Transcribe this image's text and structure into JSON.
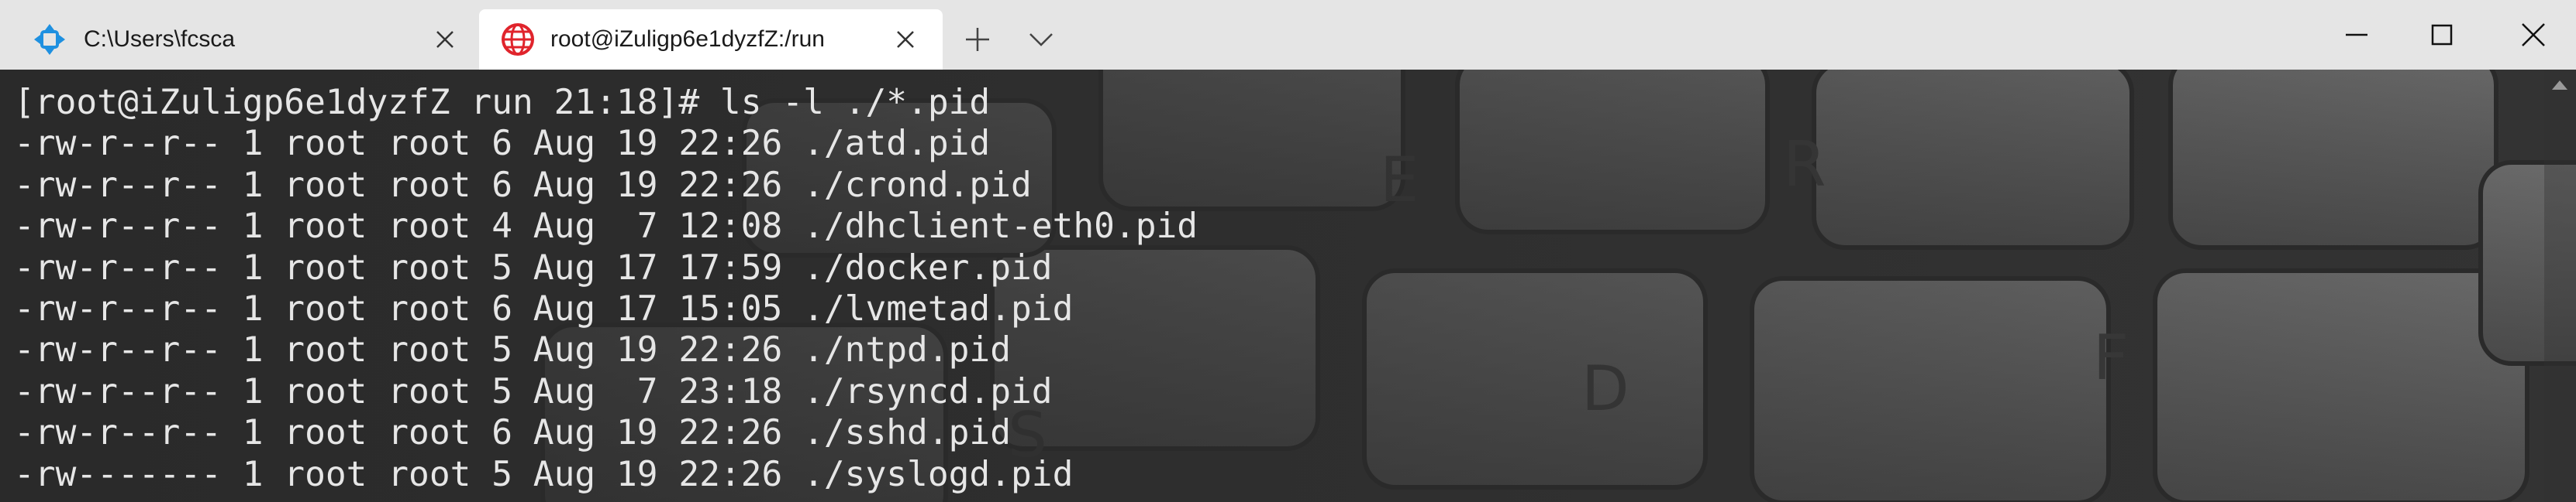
{
  "tabs": [
    {
      "title": "C:\\Users\\fcsca",
      "icon": "windows-terminal-icon",
      "active": false
    },
    {
      "title": "root@iZuligp6e1dyzfZ:/run",
      "icon": "globe-icon",
      "active": true
    }
  ],
  "window_controls": {
    "new_tab": "plus-icon",
    "dropdown": "chevron-down-icon",
    "minimize": "minimize-icon",
    "maximize": "maximize-icon",
    "close": "close-icon"
  },
  "terminal": {
    "lines": [
      "[root@iZuligp6e1dyzfZ run 21:18]# ls -l ./*.pid",
      "-rw-r--r-- 1 root root 6 Aug 19 22:26 ./atd.pid",
      "-rw-r--r-- 1 root root 6 Aug 19 22:26 ./crond.pid",
      "-rw-r--r-- 1 root root 4 Aug  7 12:08 ./dhclient-eth0.pid",
      "-rw-r--r-- 1 root root 5 Aug 17 17:59 ./docker.pid",
      "-rw-r--r-- 1 root root 6 Aug 17 15:05 ./lvmetad.pid",
      "-rw-r--r-- 1 root root 5 Aug 19 22:26 ./ntpd.pid",
      "-rw-r--r-- 1 root root 5 Aug  7 23:18 ./rsyncd.pid",
      "-rw-r--r-- 1 root root 6 Aug 19 22:26 ./sshd.pid",
      "-rw------- 1 root root 5 Aug 19 22:26 ./syslogd.pid"
    ],
    "background_key_letters": [
      "E",
      "R",
      "D",
      "F",
      "S"
    ]
  },
  "colors": {
    "titlebar": "#e5e5e5",
    "active_tab": "#ffffff",
    "terminal_bg": "#2d2d2d",
    "terminal_fg": "#e6e6e6",
    "accent_blue": "#1e90e0",
    "globe_red": "#e0242c"
  }
}
